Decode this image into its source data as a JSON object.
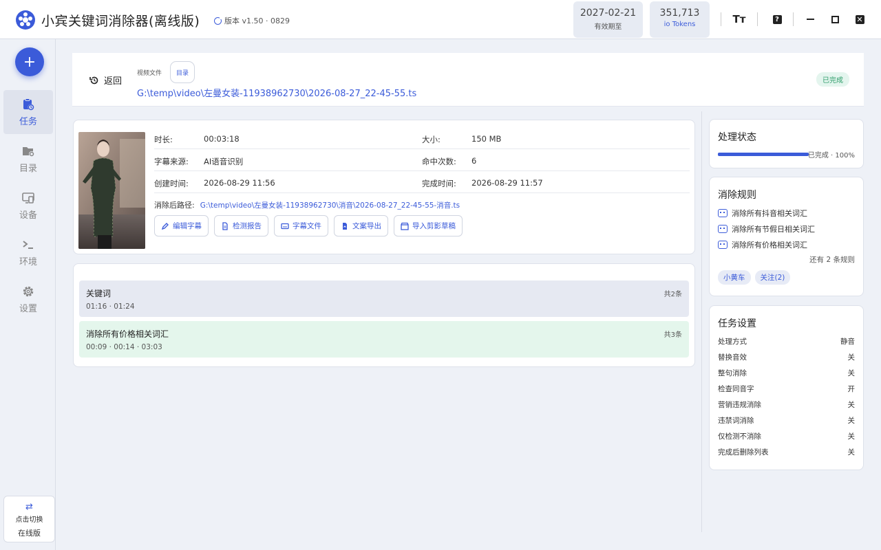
{
  "app": {
    "title": "小宾关键词消除器(离线版)",
    "version": "版本 v1.50 · 0829",
    "expire_value": "2027-02-21",
    "expire_label": "有效期至",
    "tokens_value": "351,713",
    "tokens_label": "Tokens",
    "font_button": "Tт",
    "help_button": "?",
    "close_button": "✕"
  },
  "sidebar": {
    "add_label": "+",
    "items": [
      {
        "label": "任务",
        "icon": "task-icon",
        "active": true
      },
      {
        "label": "目录",
        "icon": "folder-gear-icon",
        "active": false
      },
      {
        "label": "设备",
        "icon": "device-icon",
        "active": false
      },
      {
        "label": "环境",
        "icon": "terminal-icon",
        "active": false
      },
      {
        "label": "设置",
        "icon": "gear-icon",
        "active": false
      }
    ],
    "switch_line1": "点击切换",
    "switch_line2": "在线版"
  },
  "header": {
    "back_label": "返回",
    "file_label": "视频文件",
    "dir_button": "目录",
    "path": "G:\\temp\\video\\左曼女装-11938962730\\2026-08-27_22-45-55.ts",
    "status_badge": "已完成"
  },
  "info": {
    "duration_label": "时长:",
    "duration_value": "00:03:18",
    "size_label": "大小:",
    "size_value": "150 MB",
    "subtitle_label": "字幕来源:",
    "subtitle_value": "AI语音识别",
    "hits_label": "命中次数:",
    "hits_value": "6",
    "created_label": "创建时间:",
    "created_value": "2026-08-29 11:56",
    "finished_label": "完成时间:",
    "finished_value": "2026-08-29 11:57",
    "out_path_label": "消除后路径:",
    "out_path_value": "G:\\temp\\video\\左曼女装-11938962730\\消音\\2026-08-27_22-45-55-消音.ts",
    "buttons": [
      "编辑字幕",
      "检测报告",
      "字幕文件",
      "文案导出",
      "导入剪影草稿"
    ]
  },
  "hits": [
    {
      "title": "关键词",
      "count": "共2条",
      "times": "01:16 · 01:24",
      "color": "#e6e9f2"
    },
    {
      "title": "消除所有价格相关词汇",
      "count": "共3条",
      "times": "00:09 · 00:14 · 03:03",
      "color": "#e4f6ec"
    }
  ],
  "status_panel": {
    "title": "处理状态",
    "progress_text": "已完成 · 100%",
    "progress": 1.0
  },
  "rules_panel": {
    "title": "消除规则",
    "rules": [
      "消除所有抖音相关词汇",
      "消除所有节假日相关词汇",
      "消除所有价格相关词汇"
    ],
    "more": "还有 2 条规则",
    "tags": [
      "小黄车",
      "关注(2)"
    ]
  },
  "settings_panel": {
    "title": "任务设置",
    "rows": [
      {
        "label": "处理方式",
        "value": "静音"
      },
      {
        "label": "替换音效",
        "value": "关"
      },
      {
        "label": "整句消除",
        "value": "关"
      },
      {
        "label": "检查同音字",
        "value": "开"
      },
      {
        "label": "营销违规消除",
        "value": "关"
      },
      {
        "label": "违禁词消除",
        "value": "关"
      },
      {
        "label": "仅检测不消除",
        "value": "关"
      },
      {
        "label": "完成后删除列表",
        "value": "关"
      }
    ]
  },
  "colors": {
    "accent": "#3b5bd9",
    "success": "#2f9d6a",
    "background": "#eef1f7"
  }
}
